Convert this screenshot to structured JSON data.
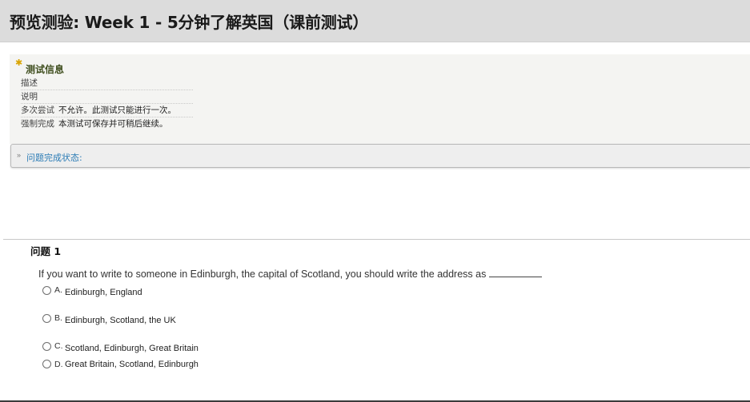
{
  "page": {
    "title": "预览测验: Week 1 - 5分钟了解英国（课前测试）"
  },
  "test_info": {
    "heading": "测试信息",
    "rows": [
      {
        "label": "描述",
        "value": ""
      },
      {
        "label": "说明",
        "value": ""
      },
      {
        "label": "多次尝试",
        "value": "不允许。此测试只能进行一次。"
      },
      {
        "label": "强制完成",
        "value": "本测试可保存并可稍后继续。"
      }
    ]
  },
  "completion_status": {
    "label": "问题完成状态:"
  },
  "question": {
    "title": "问题 1",
    "text": "If you want to write to someone in Edinburgh, the capital of Scotland, you should write the address as",
    "options": [
      {
        "letter": "A.",
        "text": "Edinburgh, England"
      },
      {
        "letter": "B.",
        "text": "Edinburgh, Scotland, the UK"
      },
      {
        "letter": "C.",
        "text": "Scotland, Edinburgh, Great Britain"
      },
      {
        "letter": "D.",
        "text": "Great Britain, Scotland, Edinburgh"
      }
    ]
  },
  "colors": {
    "title_bar": "#dcdcdc",
    "info_heading": "#3e4d1d",
    "status_link": "#2a7bb5",
    "star": "#d9a400"
  }
}
